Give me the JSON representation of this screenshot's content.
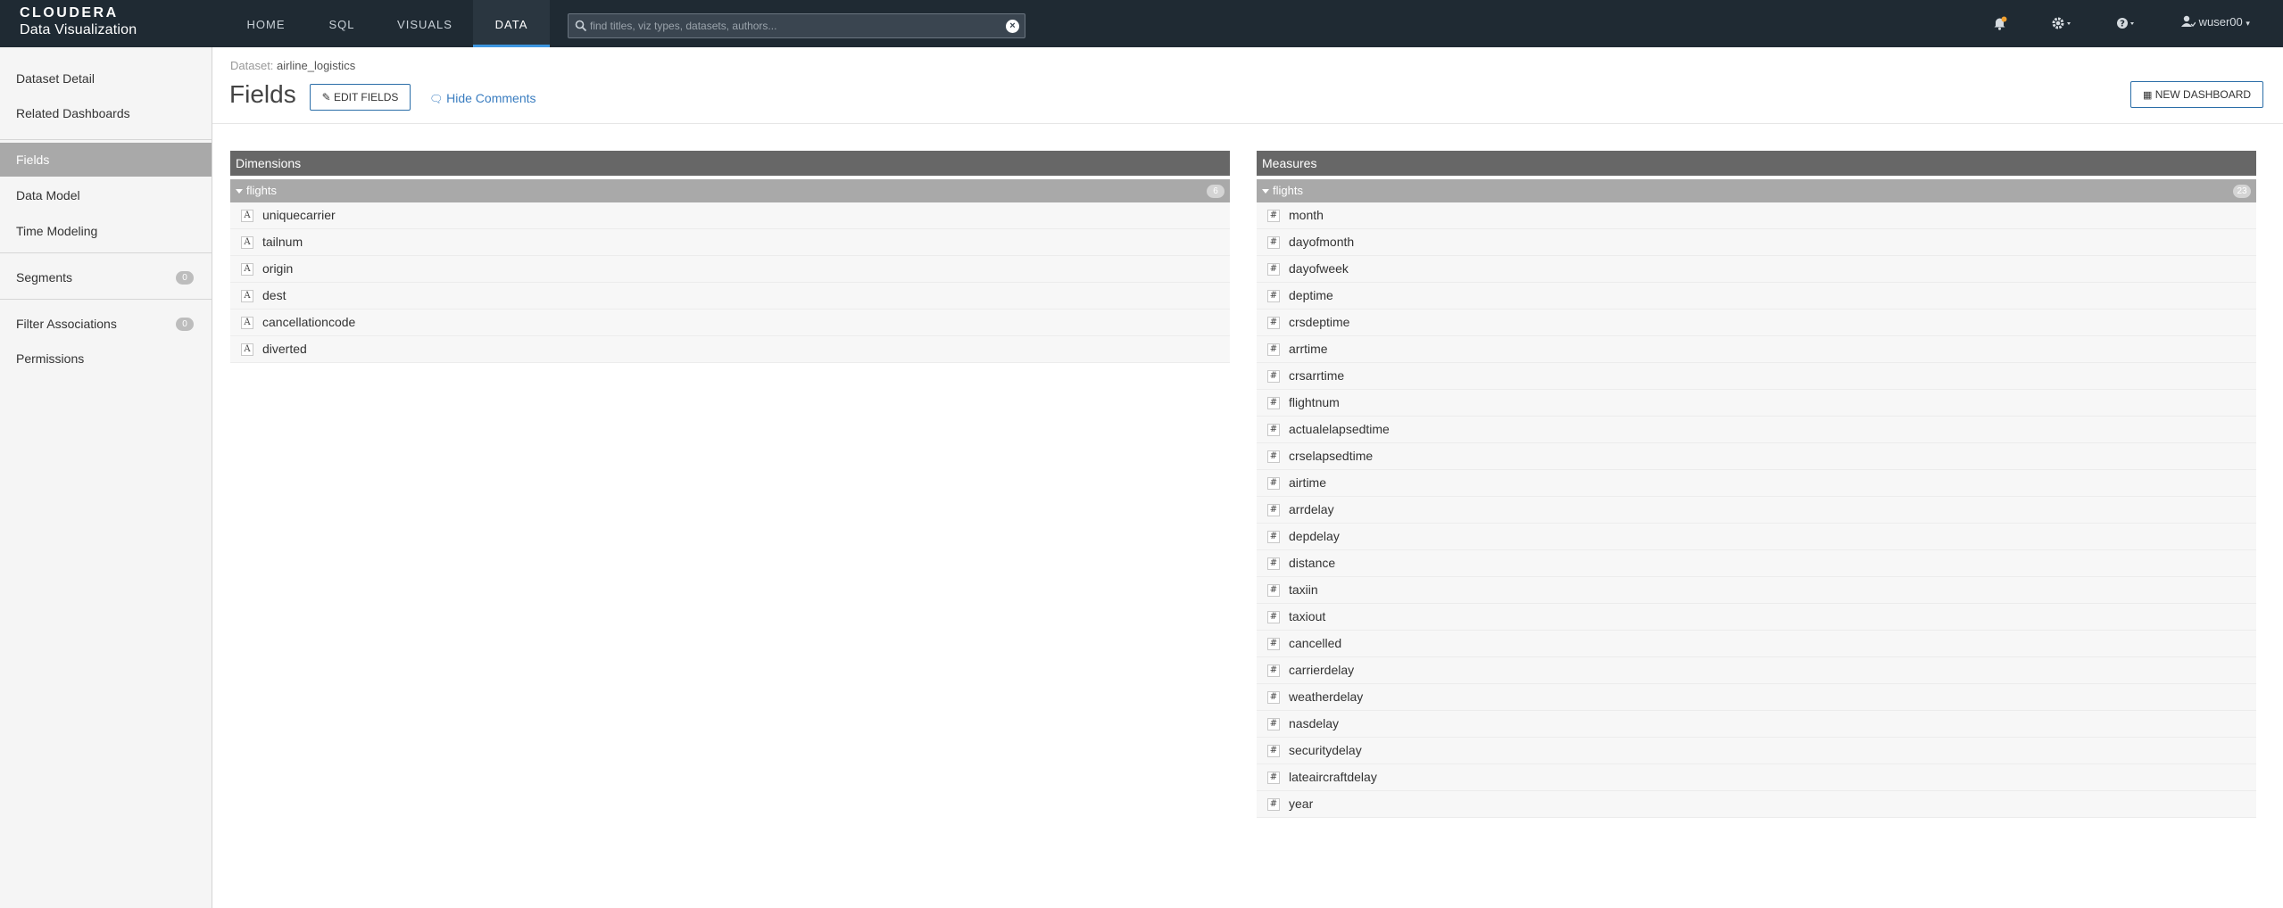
{
  "brand": {
    "line1": "CLOUDERA",
    "line2": "Data Visualization"
  },
  "nav": [
    {
      "label": "HOME"
    },
    {
      "label": "SQL"
    },
    {
      "label": "VISUALS"
    },
    {
      "label": "DATA",
      "active": true
    }
  ],
  "search": {
    "placeholder": "find titles, viz types, datasets, authors..."
  },
  "toolbar": {
    "user_label": "wuser00"
  },
  "icons": {
    "notifications": "bell-icon",
    "settings": "gear-icon",
    "help": "question-icon",
    "user": "user-icon"
  },
  "sidebar": {
    "items": [
      {
        "label": "Dataset Detail"
      },
      {
        "label": "Related Dashboards"
      },
      {
        "label": "Fields",
        "active": true
      },
      {
        "label": "Data Model"
      },
      {
        "label": "Time Modeling"
      },
      {
        "label": "Segments",
        "badge": "0"
      },
      {
        "label": "Filter Associations",
        "badge": "0"
      },
      {
        "label": "Permissions"
      }
    ]
  },
  "header": {
    "crumb_label": "Dataset:",
    "crumb_value": "airline_logistics",
    "title": "Fields",
    "edit_label": "EDIT FIELDS",
    "hide_comments_label": "Hide Comments",
    "new_dashboard_label": "NEW DASHBOARD"
  },
  "dimensions": {
    "title": "Dimensions",
    "group": "flights",
    "count": "6",
    "type_glyph": "A",
    "fields": [
      "uniquecarrier",
      "tailnum",
      "origin",
      "dest",
      "cancellationcode",
      "diverted"
    ]
  },
  "measures": {
    "title": "Measures",
    "group": "flights",
    "count": "23",
    "type_glyph": "#",
    "fields": [
      "month",
      "dayofmonth",
      "dayofweek",
      "deptime",
      "crsdeptime",
      "arrtime",
      "crsarrtime",
      "flightnum",
      "actualelapsedtime",
      "crselapsedtime",
      "airtime",
      "arrdelay",
      "depdelay",
      "distance",
      "taxiin",
      "taxiout",
      "cancelled",
      "carrierdelay",
      "weatherdelay",
      "nasdelay",
      "securitydelay",
      "lateaircraftdelay",
      "year"
    ]
  },
  "colors": {
    "topbar": "#1f2a33",
    "accent": "#3d96e0",
    "panel_header": "#676767",
    "group_header": "#a9a9a9"
  }
}
